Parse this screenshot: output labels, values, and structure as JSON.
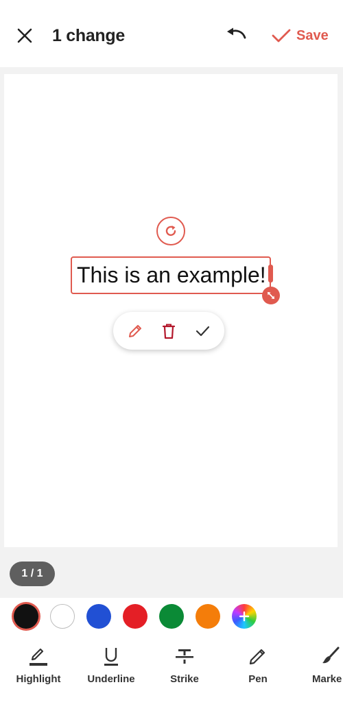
{
  "header": {
    "title": "1 change",
    "save_label": "Save"
  },
  "canvas": {
    "annotation_text": "This is an example!"
  },
  "page_indicator": "1 / 1",
  "colors": {
    "accent": "#e05a4f",
    "swatches": [
      {
        "name": "black",
        "hex": "#111111",
        "selected": true
      },
      {
        "name": "white",
        "hex": "#ffffff",
        "selected": false
      },
      {
        "name": "blue",
        "hex": "#2150d4",
        "selected": false
      },
      {
        "name": "red",
        "hex": "#e41f26",
        "selected": false
      },
      {
        "name": "green",
        "hex": "#0b8a36",
        "selected": false
      },
      {
        "name": "orange",
        "hex": "#f47d0a",
        "selected": false
      },
      {
        "name": "custom-color",
        "hex": "conic-gradient",
        "selected": false
      }
    ]
  },
  "tools": [
    {
      "label": "Highlight",
      "icon": "highlight-icon"
    },
    {
      "label": "Underline",
      "icon": "underline-icon"
    },
    {
      "label": "Strike",
      "icon": "strikethrough-icon"
    },
    {
      "label": "Pen",
      "icon": "pen-icon"
    },
    {
      "label": "Marke",
      "icon": "marker-icon"
    }
  ]
}
